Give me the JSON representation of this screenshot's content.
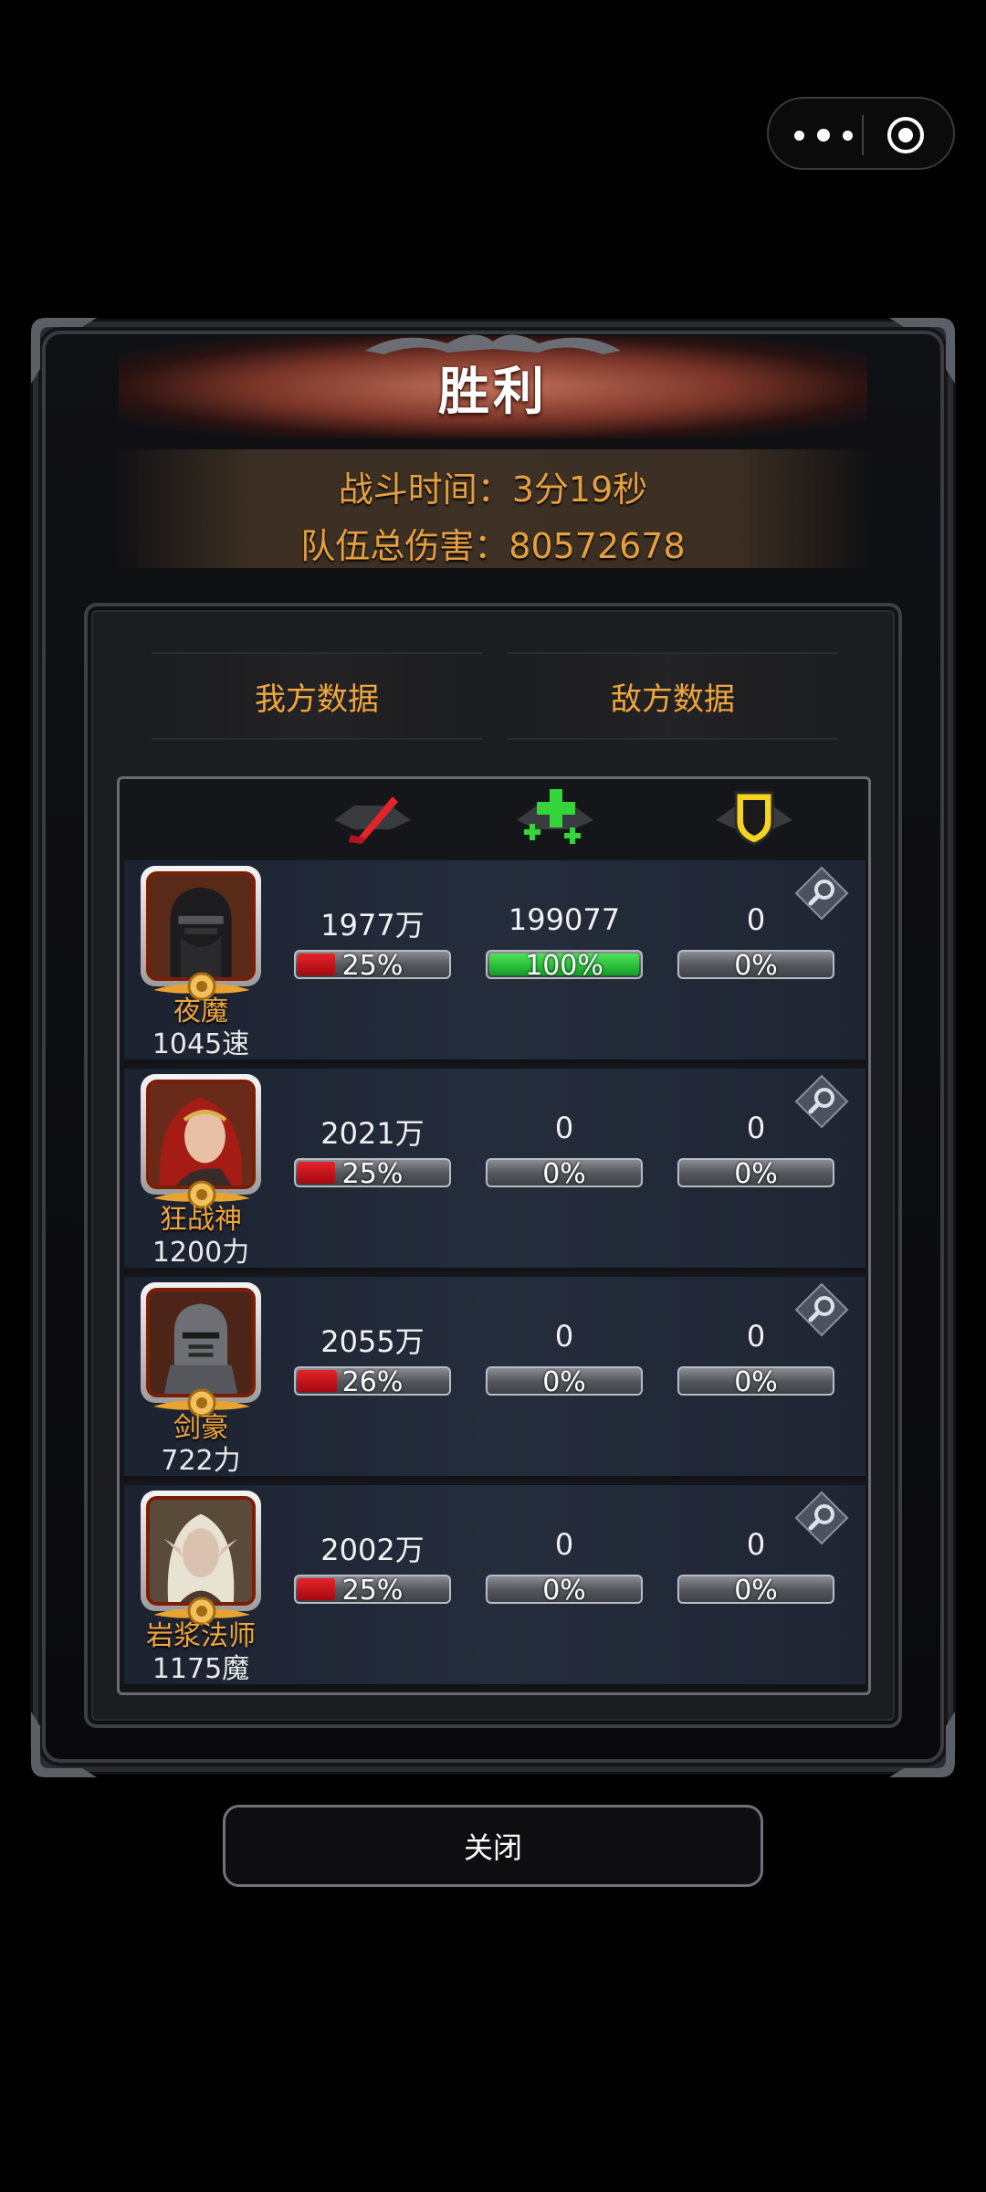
{
  "title": "胜利",
  "summary": {
    "battle_time_label": "战斗时间：3分19秒",
    "total_damage_label": "队伍总伤害：80572678"
  },
  "tabs": [
    {
      "label": "我方数据"
    },
    {
      "label": "敌方数据"
    }
  ],
  "columns": [
    {
      "icon": "sword-icon",
      "color": "#e5232a"
    },
    {
      "icon": "heal-icon",
      "color": "#35d43b"
    },
    {
      "icon": "shield-icon",
      "color": "#f5d320"
    }
  ],
  "heroes": [
    {
      "name": "夜魔",
      "stat": "1045速",
      "portrait": "dark-knight-portrait",
      "damage": "1977万",
      "damage_pct": "25%",
      "damage_ratio": 0.25,
      "heal": "199077",
      "heal_pct": "100%",
      "heal_ratio": 1.0,
      "shield": "0",
      "shield_pct": "0%",
      "shield_ratio": 0
    },
    {
      "name": "狂战神",
      "stat": "1200力",
      "portrait": "red-haired-warrior-portrait",
      "damage": "2021万",
      "damage_pct": "25%",
      "damage_ratio": 0.25,
      "heal": "0",
      "heal_pct": "0%",
      "heal_ratio": 0,
      "shield": "0",
      "shield_pct": "0%",
      "shield_ratio": 0
    },
    {
      "name": "剑豪",
      "stat": "722力",
      "portrait": "armored-knight-portrait",
      "damage": "2055万",
      "damage_pct": "26%",
      "damage_ratio": 0.26,
      "heal": "0",
      "heal_pct": "0%",
      "heal_ratio": 0,
      "shield": "0",
      "shield_pct": "0%",
      "shield_ratio": 0
    },
    {
      "name": "岩浆法师",
      "stat": "1175魔",
      "portrait": "elf-mage-portrait",
      "damage": "2002万",
      "damage_pct": "25%",
      "damage_ratio": 0.25,
      "heal": "0",
      "heal_pct": "0%",
      "heal_ratio": 0,
      "shield": "0",
      "shield_pct": "0%",
      "shield_ratio": 0
    }
  ],
  "close_label": "关闭"
}
